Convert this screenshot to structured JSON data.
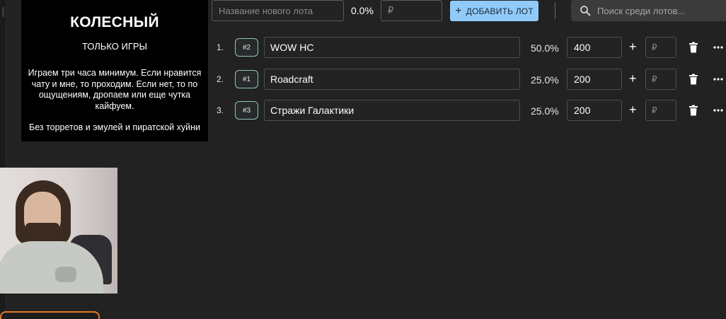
{
  "rules": {
    "title": "КОЛЕСНЫЙ",
    "subtitle": "ТОЛЬКО ИГРЫ",
    "description": "Играем три часа минимум. Если нравится чату и мне, то проходим. Если нет, то по ощущениям, дропаем или еще чутка кайфуем.",
    "note": "Без торретов и эмулей и пиратской хуйни"
  },
  "new_lot": {
    "name_placeholder": "Название нового лота",
    "percent": "0.0%",
    "price_placeholder": "₽",
    "add_label": "ДОБАВИТЬ ЛОТ"
  },
  "search": {
    "placeholder": "Поиск среди лотов..."
  },
  "lots": [
    {
      "index": "1.",
      "id": "#2",
      "name": "WOW HC",
      "percent": "50.0%",
      "amount": "400",
      "add_placeholder": "₽"
    },
    {
      "index": "2.",
      "id": "#1",
      "name": "Roadcraft",
      "percent": "25.0%",
      "amount": "200",
      "add_placeholder": "₽"
    },
    {
      "index": "3.",
      "id": "#3",
      "name": "Стражи Галактики",
      "percent": "25.0%",
      "amount": "200",
      "add_placeholder": "₽"
    }
  ],
  "icons": {
    "add": "plus-icon",
    "search": "search-icon",
    "delete": "trash-icon",
    "more": "more-horizontal-icon"
  },
  "colors": {
    "background": "#222222",
    "accent": "#90caf9",
    "id_badge_border": "#8fc5c0",
    "stream_card_border": "#e8762a"
  }
}
